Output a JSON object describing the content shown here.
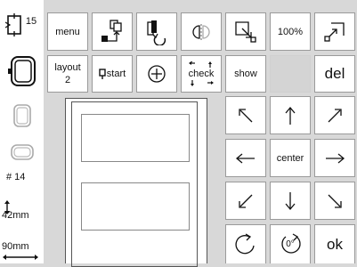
{
  "sidebar": {
    "hoop_number": "15",
    "pattern_number": "# 14",
    "height": "42mm",
    "width": "90mm"
  },
  "toolbar": {
    "menu": "menu",
    "layout_label": "layout",
    "layout_value": "2",
    "start": "start",
    "check": "check",
    "show": "show",
    "del": "del"
  },
  "zoom": {
    "value": "100%"
  },
  "nav": {
    "center": "center",
    "rotate_label": "0°",
    "ok": "ok"
  }
}
